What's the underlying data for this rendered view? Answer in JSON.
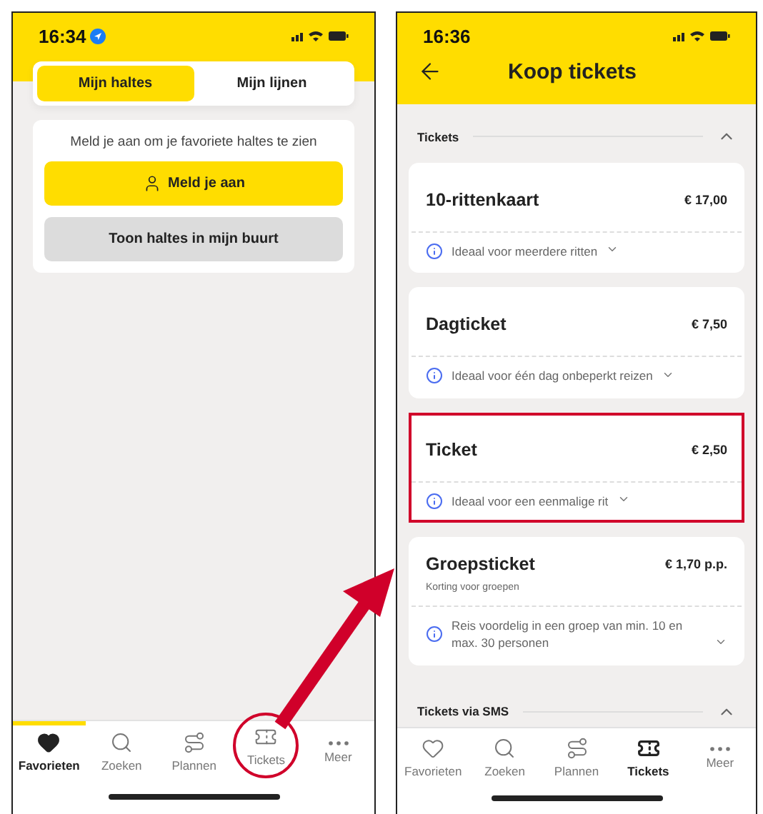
{
  "left_screen": {
    "status_bar": {
      "time": "16:34"
    },
    "segments": [
      {
        "label": "Mijn haltes",
        "selected": true
      },
      {
        "label": "Mijn lijnen",
        "selected": false
      }
    ],
    "login_card": {
      "message": "Meld je aan om je favoriete haltes te zien",
      "login_button": "Meld je aan",
      "nearby_button": "Toon haltes in mijn buurt"
    },
    "tab_bar": [
      {
        "kind": "heart",
        "label": "Favorieten",
        "selected": true,
        "circled": false
      },
      {
        "kind": "search",
        "label": "Zoeken",
        "selected": false,
        "circled": false
      },
      {
        "kind": "route",
        "label": "Plannen",
        "selected": false,
        "circled": false
      },
      {
        "kind": "ticket",
        "label": "Tickets",
        "selected": false,
        "circled": true
      },
      {
        "kind": "more",
        "label": "Meer",
        "selected": false,
        "circled": false
      }
    ]
  },
  "right_screen": {
    "status_bar": {
      "time": "16:36"
    },
    "title": "Koop tickets",
    "sections": [
      {
        "title": "Tickets",
        "expanded": true,
        "tickets": [
          {
            "name": "10-rittenkaart",
            "price": "€ 17,00",
            "info": "Ideaal voor meerdere ritten",
            "highlighted": false
          },
          {
            "name": "Dagticket",
            "price": "€ 7,50",
            "info": "Ideaal voor één dag onbeperkt reizen",
            "highlighted": false
          },
          {
            "name": "Ticket",
            "price": "€ 2,50",
            "info": "Ideaal voor een eenmalige rit",
            "highlighted": true
          },
          {
            "name": "Groepsticket",
            "price": "€ 1,70 p.p.",
            "subtitle": "Korting voor groepen",
            "info": "Reis voordelig in een groep van min. 10 en max. 30 personen",
            "highlighted": false
          }
        ]
      },
      {
        "title": "Tickets via SMS",
        "expanded": true
      }
    ],
    "tab_bar": [
      {
        "kind": "heart",
        "label": "Favorieten",
        "selected": false,
        "circled": false
      },
      {
        "kind": "search",
        "label": "Zoeken",
        "selected": false,
        "circled": false
      },
      {
        "kind": "route",
        "label": "Plannen",
        "selected": false,
        "circled": false
      },
      {
        "kind": "ticket",
        "label": "Tickets",
        "selected": true,
        "circled": false
      },
      {
        "kind": "more",
        "label": "Meer",
        "selected": false,
        "circled": false
      }
    ]
  }
}
